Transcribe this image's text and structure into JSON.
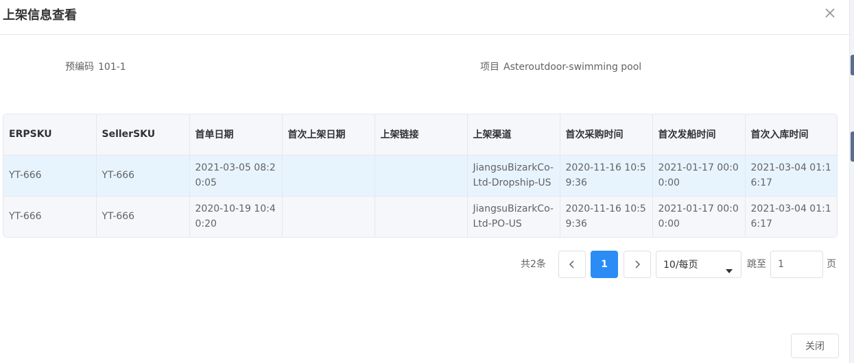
{
  "dialog": {
    "title": "上架信息查看",
    "close_icon": "close-icon"
  },
  "info": {
    "code_label": "预编码",
    "code_value": "101-1",
    "project_label": "项目",
    "project_value": "Asteroutdoor-swimming pool"
  },
  "table": {
    "columns": [
      "ERPSKU",
      "SellerSKU",
      "首单日期",
      "首次上架日期",
      "上架链接",
      "上架渠道",
      "首次采购时间",
      "首次发船时间",
      "首次入库时间"
    ],
    "rows": [
      [
        "YT-666",
        "YT-666",
        "2021-03-05 08:20:05",
        "",
        "",
        "JiangsuBizarkCo-Ltd-Dropship-US",
        "2020-11-16 10:59:36",
        "2021-01-17 00:00:00",
        "2021-03-04 01:16:17"
      ],
      [
        "YT-666",
        "YT-666",
        "2020-10-19 10:40:20",
        "",
        "",
        "JiangsuBizarkCo-Ltd-PO-US",
        "2020-11-16 10:59:36",
        "2021-01-17 00:00:00",
        "2021-03-04 01:16:17"
      ]
    ]
  },
  "pagination": {
    "total_text": "共2条",
    "current_page": "1",
    "page_size": "10/每页",
    "goto_label": "跳至",
    "goto_value": "1",
    "goto_unit": "页",
    "prev_icon": "chevron-left-icon",
    "next_icon": "chevron-right-icon"
  },
  "footer": {
    "close_label": "关闭"
  },
  "colors": {
    "accent": "#2a8cf4",
    "row_highlight": "#e8f4fd",
    "header_bg": "#f5f7fa",
    "border": "#e4e7ed"
  }
}
